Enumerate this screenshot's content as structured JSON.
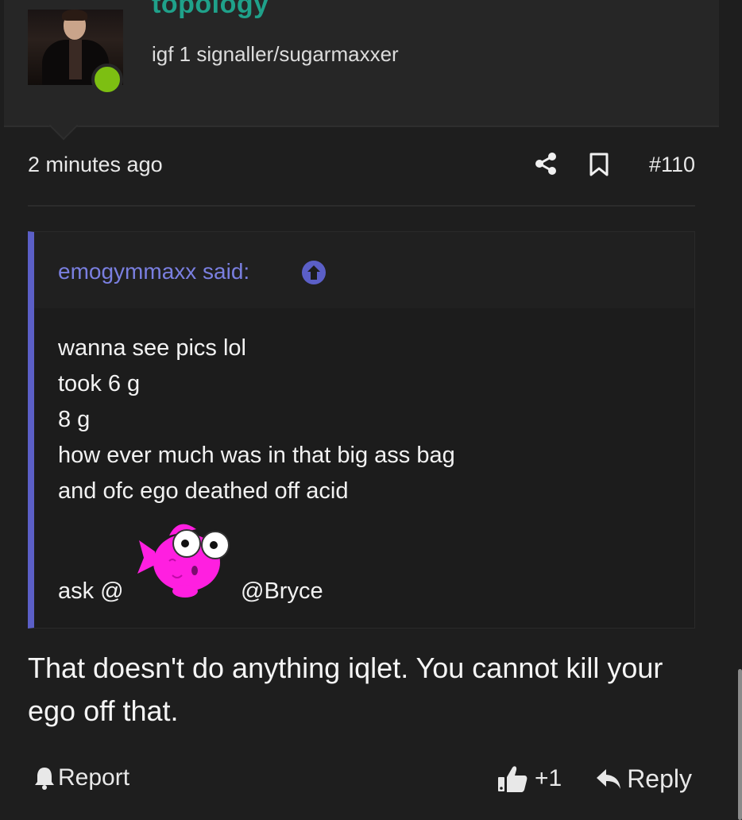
{
  "user": {
    "username": "topology",
    "title": "igf 1 signaller/sugarmaxxer",
    "status_color": "#7dbf12"
  },
  "post": {
    "timestamp": "2 minutes ago",
    "number": "#110",
    "share_icon": "share-icon",
    "bookmark_icon": "bookmark-icon"
  },
  "quote": {
    "author": "emogymmaxx said:",
    "accent_color": "#5b5fc7",
    "lines": [
      "wanna see pics lol",
      "took 6 g",
      "8 g",
      "how ever much was in that big ass bag",
      "and ofc ego deathed off acid"
    ],
    "ask_prefix": "ask @",
    "mention": "@Bryce"
  },
  "message": {
    "text": "That doesn't do anything iqlet. You cannot kill your ego off that."
  },
  "actions": {
    "report": "Report",
    "like": "+1",
    "reply": "Reply"
  }
}
